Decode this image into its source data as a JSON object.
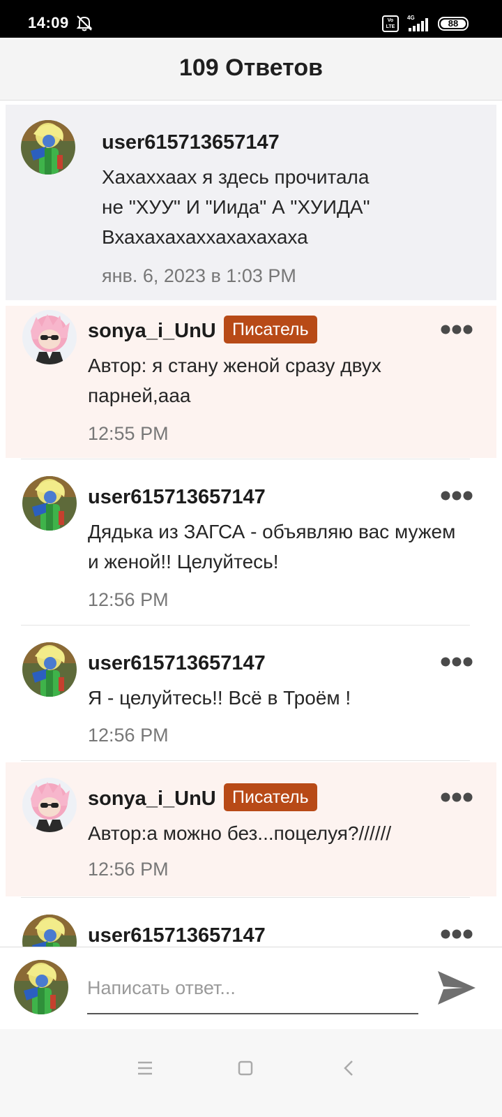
{
  "status_bar": {
    "time": "14:09",
    "bell_icon": "bell-off-icon",
    "volte": "Vo LTE",
    "network": "4G",
    "battery": "88"
  },
  "header": {
    "title": "109 Ответов"
  },
  "comments": [
    {
      "username": "user615713657147",
      "badge": "",
      "text": "Хахаххаах я здесь прочитала\nне \"ХУУ\" И \"Иида\" А \"ХУИДА\"\nВхахахахаххахахахаха",
      "time": "янв. 6, 2023 в 1:03 PM"
    },
    {
      "username": "sonya_i_UnU",
      "badge": "Писатель",
      "text": "Автор: я стану женой сразу двух\nпарней,ааа",
      "time": "12:55 PM"
    },
    {
      "username": "user615713657147",
      "badge": "",
      "text": "Дядька из ЗАГСА - объявляю вас мужем\nи женой!! Целуйтесь!",
      "time": "12:56 PM"
    },
    {
      "username": "user615713657147",
      "badge": "",
      "text": "Я - целуйтесь!! Всё в Троём !",
      "time": "12:56 PM"
    },
    {
      "username": "sonya_i_UnU",
      "badge": "Писатель",
      "text": "Автор:а можно без...поцелуя?//////",
      "time": "12:56 PM"
    },
    {
      "username": "user615713657147",
      "badge": "",
      "text": "",
      "time": ""
    }
  ],
  "reply": {
    "placeholder": "Написать ответ...",
    "send_icon": "send-icon"
  },
  "nav": {
    "menu_icon": "menu-icon",
    "home_icon": "home-square-icon",
    "back_icon": "back-chevron-icon"
  },
  "colors": {
    "badge": "#b84a17",
    "writer_bg": "#fdf3f0",
    "parent_bg": "#f1f1f4"
  }
}
